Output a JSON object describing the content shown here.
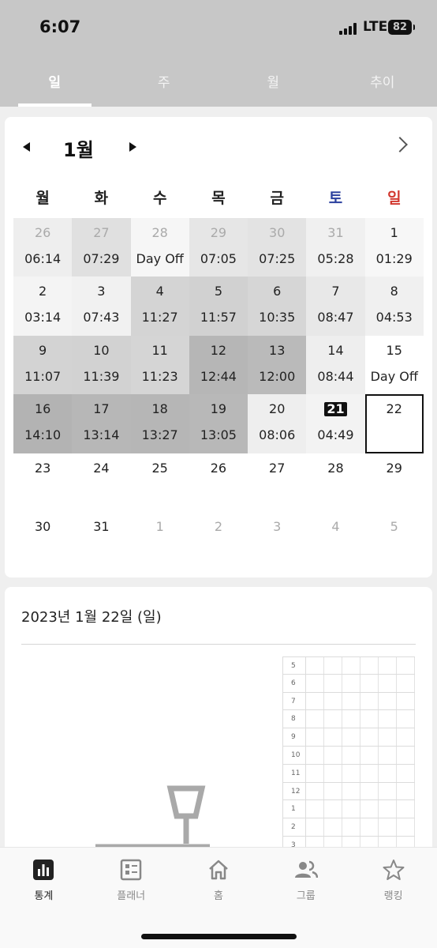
{
  "status": {
    "time": "6:07",
    "network": "LTE",
    "battery": "82"
  },
  "tabs": [
    {
      "label": "일",
      "active": true
    },
    {
      "label": "주",
      "active": false
    },
    {
      "label": "월",
      "active": false
    },
    {
      "label": "추이",
      "active": false
    }
  ],
  "calendar": {
    "month_label": "1월",
    "weekdays": [
      {
        "label": "월",
        "color": "#222222"
      },
      {
        "label": "화",
        "color": "#222222"
      },
      {
        "label": "수",
        "color": "#222222"
      },
      {
        "label": "목",
        "color": "#222222"
      },
      {
        "label": "금",
        "color": "#222222"
      },
      {
        "label": "토",
        "color": "#2a3f9e"
      },
      {
        "label": "일",
        "color": "#d2382f"
      }
    ],
    "days": [
      {
        "day": "26",
        "hours": "06:14",
        "bg": "#eeeeee",
        "muted": true
      },
      {
        "day": "27",
        "hours": "07:29",
        "bg": "#e0e0e0",
        "muted": true
      },
      {
        "day": "28",
        "hours": "Day Off",
        "bg": "#f6f6f6",
        "muted": true
      },
      {
        "day": "29",
        "hours": "07:05",
        "bg": "#e6e6e6",
        "muted": true
      },
      {
        "day": "30",
        "hours": "07:25",
        "bg": "#e3e3e3",
        "muted": true
      },
      {
        "day": "31",
        "hours": "05:28",
        "bg": "#f0f0f0",
        "muted": true
      },
      {
        "day": "1",
        "hours": "01:29",
        "bg": "#f7f7f7",
        "muted": false
      },
      {
        "day": "2",
        "hours": "03:14",
        "bg": "#f4f4f4",
        "muted": false
      },
      {
        "day": "3",
        "hours": "07:43",
        "bg": "#f1f1f1",
        "muted": false
      },
      {
        "day": "4",
        "hours": "11:27",
        "bg": "#d4d4d4",
        "muted": false
      },
      {
        "day": "5",
        "hours": "11:57",
        "bg": "#d1d1d1",
        "muted": false
      },
      {
        "day": "6",
        "hours": "10:35",
        "bg": "#d6d6d6",
        "muted": false
      },
      {
        "day": "7",
        "hours": "08:47",
        "bg": "#e8e8e8",
        "muted": false
      },
      {
        "day": "8",
        "hours": "04:53",
        "bg": "#f0f0f0",
        "muted": false
      },
      {
        "day": "9",
        "hours": "11:07",
        "bg": "#d3d3d3",
        "muted": false
      },
      {
        "day": "10",
        "hours": "11:39",
        "bg": "#d2d2d2",
        "muted": false
      },
      {
        "day": "11",
        "hours": "11:23",
        "bg": "#d5d5d5",
        "muted": false
      },
      {
        "day": "12",
        "hours": "12:44",
        "bg": "#b6b6b6",
        "muted": false
      },
      {
        "day": "13",
        "hours": "12:00",
        "bg": "#bababa",
        "muted": false
      },
      {
        "day": "14",
        "hours": "08:44",
        "bg": "#eeeeee",
        "muted": false
      },
      {
        "day": "15",
        "hours": "Day Off",
        "bg": "#ffffff",
        "muted": false
      },
      {
        "day": "16",
        "hours": "14:10",
        "bg": "#b3b3b3",
        "muted": false
      },
      {
        "day": "17",
        "hours": "13:14",
        "bg": "#b7b7b7",
        "muted": false
      },
      {
        "day": "18",
        "hours": "13:27",
        "bg": "#b6b6b6",
        "muted": false
      },
      {
        "day": "19",
        "hours": "13:05",
        "bg": "#b8b8b8",
        "muted": false
      },
      {
        "day": "20",
        "hours": "08:06",
        "bg": "#eeeeee",
        "muted": false
      },
      {
        "day": "21",
        "hours": "04:49",
        "bg": "#f3f3f3",
        "muted": false,
        "selected": true
      },
      {
        "day": "22",
        "hours": "",
        "bg": "#ffffff",
        "muted": false,
        "today": true
      },
      {
        "day": "23",
        "hours": "",
        "bg": "#ffffff",
        "muted": false
      },
      {
        "day": "24",
        "hours": "",
        "bg": "#ffffff",
        "muted": false
      },
      {
        "day": "25",
        "hours": "",
        "bg": "#ffffff",
        "muted": false
      },
      {
        "day": "26",
        "hours": "",
        "bg": "#ffffff",
        "muted": false
      },
      {
        "day": "27",
        "hours": "",
        "bg": "#ffffff",
        "muted": false
      },
      {
        "day": "28",
        "hours": "",
        "bg": "#ffffff",
        "muted": false
      },
      {
        "day": "29",
        "hours": "",
        "bg": "#ffffff",
        "muted": false
      },
      {
        "day": "30",
        "hours": "",
        "bg": "#ffffff",
        "muted": false
      },
      {
        "day": "31",
        "hours": "",
        "bg": "#ffffff",
        "muted": false
      },
      {
        "day": "1",
        "hours": "",
        "bg": "#ffffff",
        "muted": true
      },
      {
        "day": "2",
        "hours": "",
        "bg": "#ffffff",
        "muted": true
      },
      {
        "day": "3",
        "hours": "",
        "bg": "#ffffff",
        "muted": true
      },
      {
        "day": "4",
        "hours": "",
        "bg": "#ffffff",
        "muted": true
      },
      {
        "day": "5",
        "hours": "",
        "bg": "#ffffff",
        "muted": true
      }
    ]
  },
  "day_detail": {
    "title": "2023년 1월 22일 (일)",
    "timeline_hours": [
      "5",
      "6",
      "7",
      "8",
      "9",
      "10",
      "11",
      "12",
      "1",
      "2",
      "3"
    ]
  },
  "nav": [
    {
      "label": "통계",
      "icon": "stats-icon",
      "active": true
    },
    {
      "label": "플래너",
      "icon": "planner-icon",
      "active": false
    },
    {
      "label": "홈",
      "icon": "home-icon",
      "active": false
    },
    {
      "label": "그룹",
      "icon": "group-icon",
      "active": false
    },
    {
      "label": "랭킹",
      "icon": "star-icon",
      "active": false
    }
  ]
}
